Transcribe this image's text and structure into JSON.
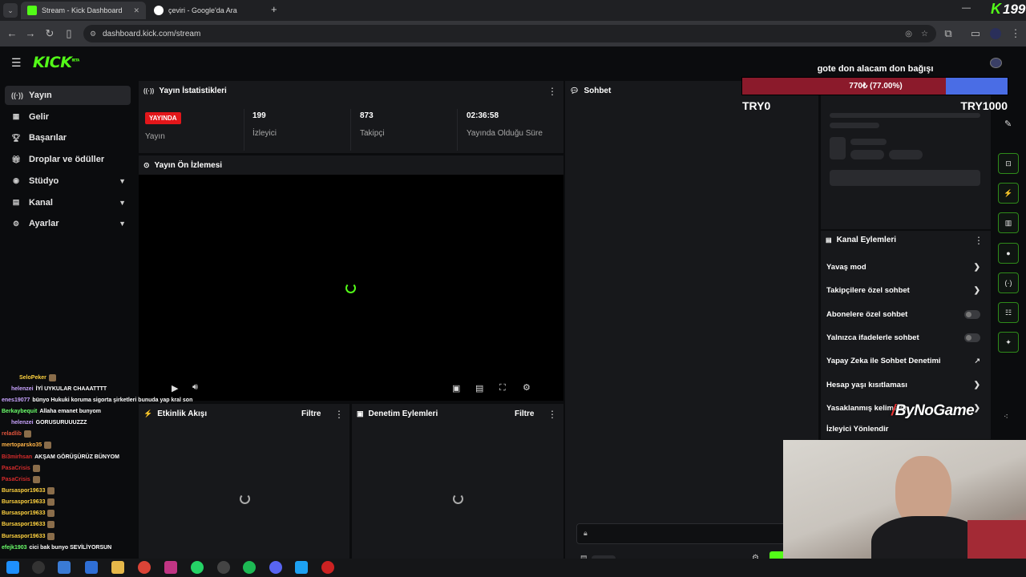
{
  "browser": {
    "tabs": [
      {
        "title": "Stream - Kick Dashboard",
        "active": true
      },
      {
        "title": "çeviri - Google'da Ara",
        "active": false
      }
    ],
    "url": "dashboard.kick.com/stream"
  },
  "overlay": {
    "viewer_count": "199",
    "donation_goal": {
      "title": "gote don alacam don bağışı",
      "bar_label": "770₺ (77.00%)",
      "progress": 0.77,
      "min_label": "TRY0",
      "max_label": "TRY1000",
      "fill_color": "#8b1a2b",
      "rest_color": "#4a6de5"
    },
    "watermark": "ByNoGame"
  },
  "brand": {
    "logo": "KICK",
    "logo_sup": "BETA",
    "accent": "#53fc18"
  },
  "sidebar": {
    "items": [
      {
        "label": "Yayın",
        "icon": "broadcast-icon",
        "active": true,
        "expandable": false
      },
      {
        "label": "Gelir",
        "icon": "revenue-icon",
        "active": false,
        "expandable": false
      },
      {
        "label": "Başarılar",
        "icon": "trophy-icon",
        "active": false,
        "expandable": false
      },
      {
        "label": "Droplar ve ödüller",
        "icon": "gift-icon",
        "active": false,
        "expandable": false
      },
      {
        "label": "Stüdyo",
        "icon": "studio-icon",
        "active": false,
        "expandable": true
      },
      {
        "label": "Kanal",
        "icon": "channel-icon",
        "active": false,
        "expandable": true
      },
      {
        "label": "Ayarlar",
        "icon": "gear-icon",
        "active": false,
        "expandable": true
      }
    ]
  },
  "stats": {
    "title": "Yayın İstatistikleri",
    "live_badge": "YAYINDA",
    "live_label": "Yayın",
    "viewers_value": "199",
    "viewers_label": "İzleyici",
    "followers_value": "873",
    "followers_label": "Takipçi",
    "uptime_value": "02:36:58",
    "uptime_label": "Yayında Olduğu Süre"
  },
  "preview": {
    "title": "Yayın Ön İzlemesi"
  },
  "activity": {
    "title": "Etkinlik Akışı",
    "filter": "Filtre"
  },
  "moderation": {
    "title": "Denetim Eylemleri",
    "filter": "Filtre"
  },
  "chat": {
    "title": "Sohbet"
  },
  "channel_actions": {
    "title": "Kanal Eylemleri",
    "items": [
      {
        "label": "Yavaş mod",
        "control": "chevron"
      },
      {
        "label": "Takipçilere özel sohbet",
        "control": "chevron"
      },
      {
        "label": "Abonelere özel sohbet",
        "control": "toggle"
      },
      {
        "label": "Yalnızca ifadelerle sohbet",
        "control": "toggle"
      },
      {
        "label": "Yapay Zeka ile Sohbet Denetimi",
        "control": "external"
      },
      {
        "label": "Hesap yaşı kısıtlaması",
        "control": "chevron"
      },
      {
        "label": "Yasaklanmış kelimeler",
        "control": "chevron"
      },
      {
        "label": "İzleyici Yönlendir",
        "control": "none"
      }
    ]
  },
  "stream_chat": [
    {
      "user": "SeloPeker",
      "color": "#ffd23f",
      "msg": ""
    },
    {
      "user": "helenzei",
      "color": "#c9a4ff",
      "msg": "İYİ UYKULAR CHAAATTTT"
    },
    {
      "user": "enes19077",
      "color": "#c9a4ff",
      "msg": "bünyo Hukuki koruma sigorta şirketleri bunuda yap kral son"
    },
    {
      "user": "Berkaybequit",
      "color": "#6bff6b",
      "msg": "Allaha emanet bunyom"
    },
    {
      "user": "helenzei",
      "color": "#c9a4ff",
      "msg": "GORUSURUUUZZZ"
    },
    {
      "user": "reladlib",
      "color": "#e0543c",
      "msg": ""
    },
    {
      "user": "mertoparsko35",
      "color": "#ffb347",
      "msg": ""
    },
    {
      "user": "Bi3mirhsan",
      "color": "#d62b2b",
      "msg": "AKŞAM GÖRÜŞÜRÜZ BÜNYOM"
    },
    {
      "user": "PasaCrisis",
      "color": "#d62b2b",
      "msg": ""
    },
    {
      "user": "PasaCrisis",
      "color": "#d62b2b",
      "msg": ""
    },
    {
      "user": "Bursaspor19633",
      "color": "#ffd23f",
      "msg": ""
    },
    {
      "user": "Bursaspor19633",
      "color": "#ffd23f",
      "msg": ""
    },
    {
      "user": "Bursaspor19633",
      "color": "#ffd23f",
      "msg": ""
    },
    {
      "user": "Bursaspor19633",
      "color": "#ffd23f",
      "msg": ""
    },
    {
      "user": "Bursaspor19633",
      "color": "#ffd23f",
      "msg": ""
    },
    {
      "user": "efejk1903",
      "color": "#6bff6b",
      "msg": "cici bak bunyo SEVİLİYORSUN"
    }
  ]
}
